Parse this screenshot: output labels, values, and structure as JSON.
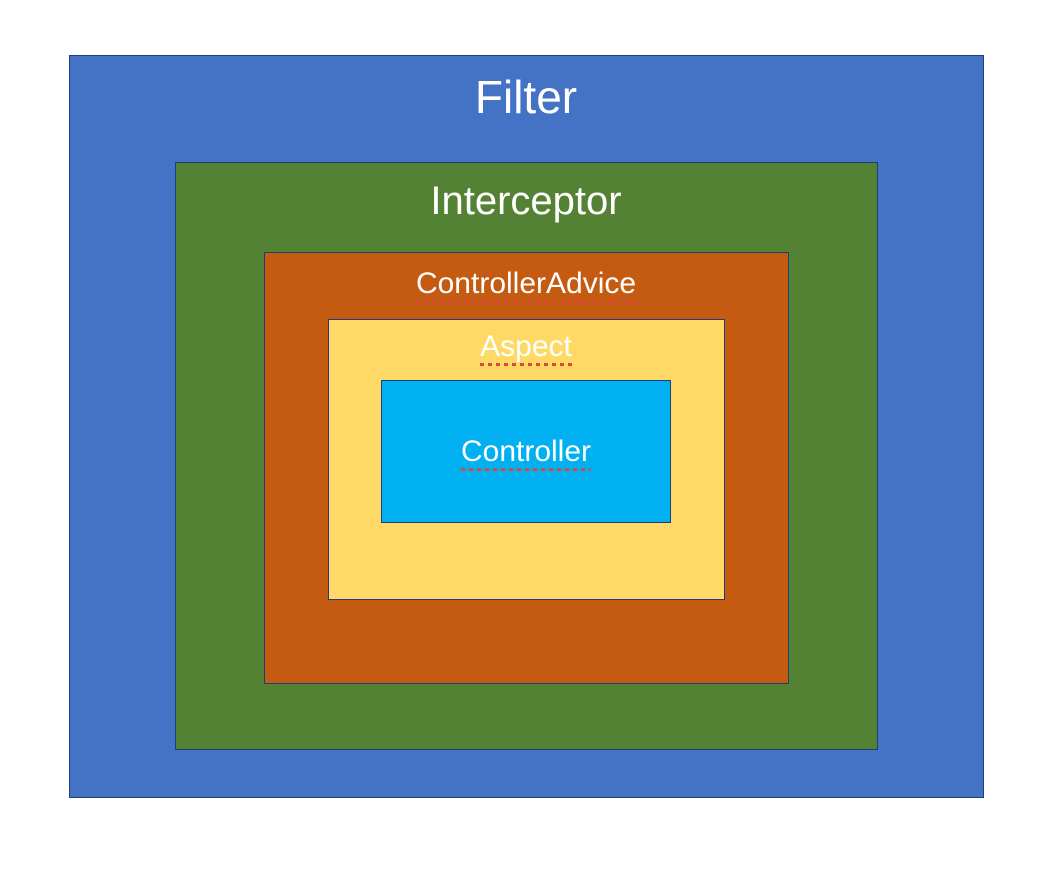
{
  "layers": {
    "filter": {
      "label": "Filter"
    },
    "interceptor": {
      "label": "Interceptor"
    },
    "controllerAdvice": {
      "label": "ControllerAdvice"
    },
    "aspect": {
      "label": "Aspect"
    },
    "controller": {
      "label": "Controller"
    }
  },
  "colors": {
    "filter": "#4472c4",
    "interceptor": "#548235",
    "controllerAdvice": "#c55a11",
    "aspect": "#ffd966",
    "controller": "#00b0f0"
  }
}
